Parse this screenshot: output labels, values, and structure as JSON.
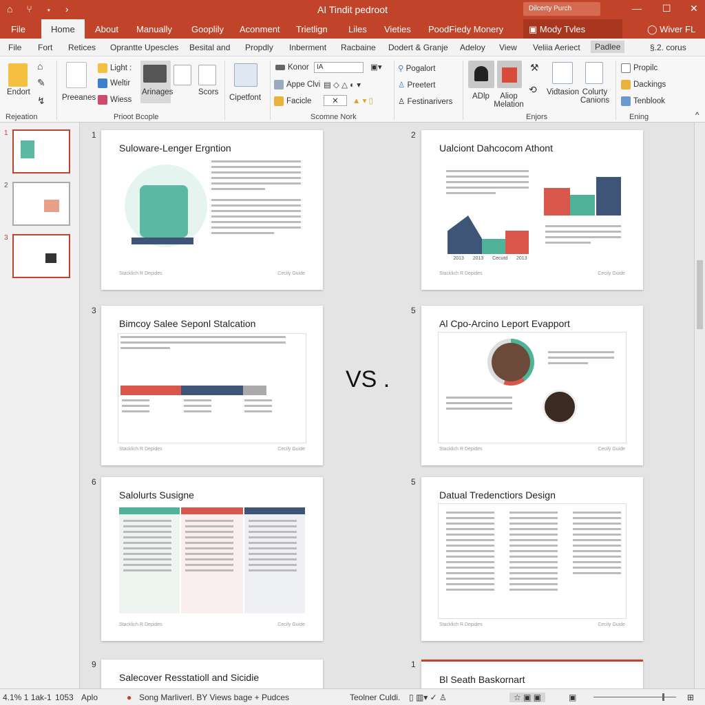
{
  "window": {
    "title": "AI Tindit pedroot",
    "search_placeholder": "Dilcerty Purch",
    "minimize": "—",
    "maximize": "☐",
    "close": "✕",
    "quick_access": "⌂ ⑂ ▾ ›"
  },
  "tabs": [
    {
      "label": "File"
    },
    {
      "label": "Home"
    },
    {
      "label": "About"
    },
    {
      "label": "Manually"
    },
    {
      "label": "Gooplily"
    },
    {
      "label": "Aconment"
    },
    {
      "label": "Trietlign"
    },
    {
      "label": "Liles"
    },
    {
      "label": "Vieties"
    },
    {
      "label": "PoodFiedy Monery"
    },
    {
      "label": "Mody Tvles"
    },
    {
      "label": "Wiver FL"
    }
  ],
  "commands": [
    {
      "label": "File"
    },
    {
      "label": "Fort"
    },
    {
      "label": "Retices"
    },
    {
      "label": "Oprantte Upescles"
    },
    {
      "label": "Besital and"
    },
    {
      "label": "Propdly"
    },
    {
      "label": "Inberment"
    },
    {
      "label": "Racbaine"
    },
    {
      "label": "Dodert & Granje"
    },
    {
      "label": "Adeloy"
    },
    {
      "label": "View"
    },
    {
      "label": "Veliia Aeriect"
    },
    {
      "label": "Padlee"
    },
    {
      "label": "§.2. corus"
    }
  ],
  "ribbon": {
    "groups": [
      {
        "label": "Rejeation"
      },
      {
        "label": "Prioot Bcople"
      },
      {
        "label": "Scomne Nork"
      },
      {
        "label": "Enjors"
      },
      {
        "label": "Ening"
      }
    ],
    "buttons": {
      "endort": "Endort",
      "presentes": "Preeanes",
      "light": "Light :",
      "weltir": "Weltir",
      "wiess": "Wiess",
      "arinages": "Arinages",
      "scors": "Scors",
      "cipetfont": "Cipetfont",
      "konor": "Konor",
      "font_value": "IA",
      "appe": "Appe Clvi",
      "facicle": "Facicle",
      "pogalort": "Pogalort",
      "preetert": "Preetert",
      "festinarivers": "Festinarivers",
      "adlp": "ADlp",
      "aliop": "Aliop Melation",
      "vidtasion": "Vidtasion",
      "colurty": "Colurty Canions",
      "propilc": "Propilc",
      "dackings": "Dackings",
      "tenblook": "Tenblook"
    }
  },
  "thumbnails": [
    {
      "number": "1"
    },
    {
      "number": "2"
    },
    {
      "number": "3"
    }
  ],
  "slides": [
    {
      "number": "1",
      "title": "Suloware-Lenger Ergntion",
      "footer_left": "Stacklich R Depides",
      "footer_right": "Cecily Guide"
    },
    {
      "number": "2",
      "title": "Ualciont Dahcocom Athont",
      "footer_left": "Stacklich R Depides",
      "footer_right": "Cecily Guide",
      "chart_labels": [
        "2013",
        "2013",
        "Cecutd",
        "2013"
      ]
    },
    {
      "number": "3",
      "title": "Bimcoy Salee Seponl Stalcation",
      "footer_left": "Stacklich R Depides",
      "footer_right": "Cecily Guide"
    },
    {
      "number": "5",
      "title": "Al Cpo-Arcino Leport Evapport",
      "footer_left": "Stacklich R Depides",
      "footer_right": "Cecily Guide"
    },
    {
      "number": "6",
      "title": "Salolurts Susigne",
      "footer_left": "Stacklich R Depides",
      "footer_right": "Cecily Guide"
    },
    {
      "number": "5",
      "title": "Datual Tredenctiors Design",
      "footer_left": "Stacklich R Depides",
      "footer_right": "Cecily Guide"
    },
    {
      "number": "9",
      "title": "Salecover Resstatioll and Sicidie"
    },
    {
      "number": "1",
      "title": "Bl Seath Baskornart"
    }
  ],
  "center_label": "VS .",
  "status": {
    "position": "4.1% 1 1ak-1",
    "count": "1053",
    "mode": "Aplo",
    "info": "Song Marliverl. BY Views bage + Pudces",
    "notes": "Teolner Culdi.",
    "zoom_level": 0.85
  },
  "colors": {
    "accent": "#c0432a",
    "chart_red": "#d9574a",
    "chart_teal": "#4fb39a",
    "chart_navy": "#3f5578"
  }
}
